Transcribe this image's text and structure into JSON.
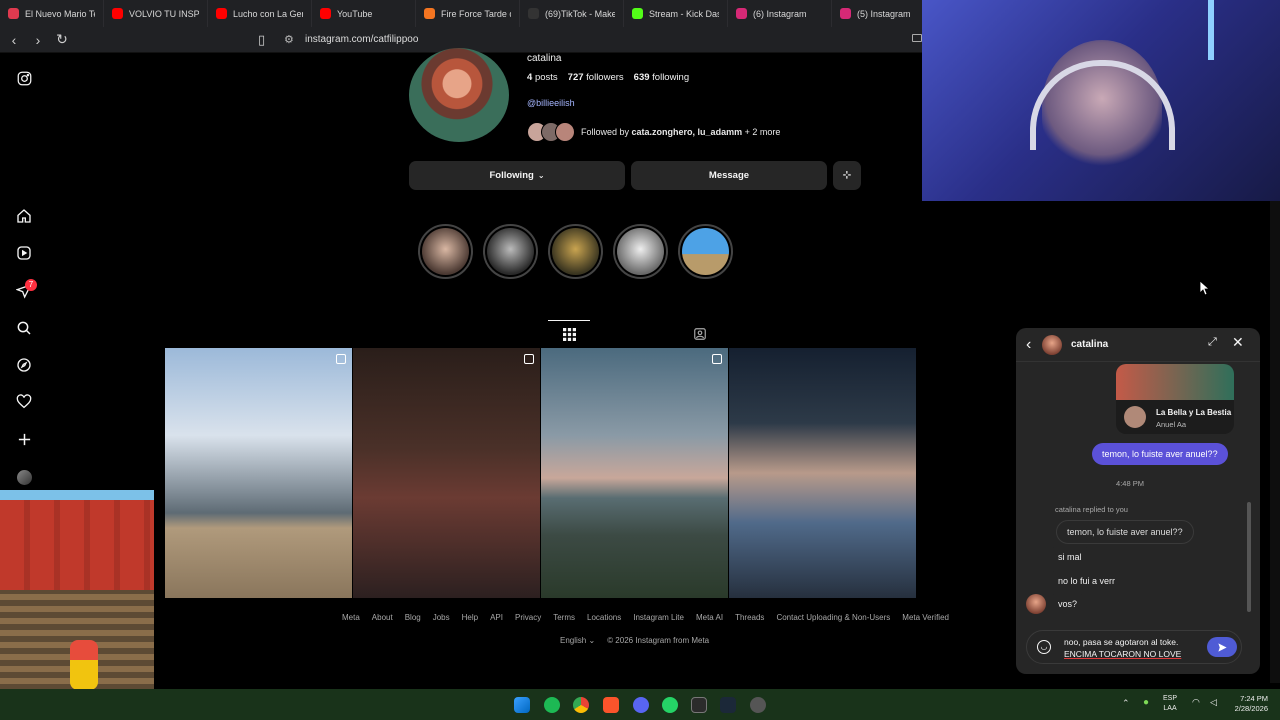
{
  "browser": {
    "tabs": [
      {
        "title": "El Nuevo Mario Ten",
        "color": "#e03a4f"
      },
      {
        "title": "VOLVIO TU INSPECT",
        "color": "#ff0000"
      },
      {
        "title": "Lucho con La Gente",
        "color": "#ff0000"
      },
      {
        "title": "YouTube",
        "color": "#ff0000"
      },
      {
        "title": "Fire Force Tarde de",
        "color": "#f47521"
      },
      {
        "title": "(69)TikTok - Make Y",
        "color": "#222222"
      },
      {
        "title": "Stream - Kick Dashb",
        "color": "#53fc18"
      },
      {
        "title": "(6) Instagram",
        "color": "#d62976"
      },
      {
        "title": "(5) Instagram",
        "color": "#d62976"
      }
    ],
    "url": "instagram.com/catfilippoo"
  },
  "sidebar": {
    "notifications_count": "7"
  },
  "profile": {
    "username": "catalina",
    "posts_count": "4",
    "posts_label": "posts",
    "followers_count": "727",
    "followers_label": "followers",
    "following_count": "639",
    "following_label": "following",
    "bio_link": "@billieeilish",
    "followed_by_prefix": "Followed by",
    "followed_by_names": "cata.zonghero, lu_adamm",
    "followed_by_more": "+ 2 more",
    "following_button": "Following",
    "message_button": "Message"
  },
  "footer": {
    "links": [
      "Meta",
      "About",
      "Blog",
      "Jobs",
      "Help",
      "API",
      "Privacy",
      "Terms",
      "Locations",
      "Instagram Lite",
      "Meta AI",
      "Threads",
      "Contact Uploading & Non-Users",
      "Meta Verified"
    ],
    "language": "English",
    "copyright": "© 2026 Instagram from Meta"
  },
  "chat": {
    "contact_name": "catalina",
    "shared_song_title": "La Bella y La Bestia",
    "shared_song_artist": "Anuel Aa",
    "msg_out_1": "temon, lo fuiste aver anuel??",
    "timestamp": "4:48 PM",
    "reply_note": "catalina replied to you",
    "quoted_reply": "temon, lo fuiste aver anuel??",
    "msg_in_1": "si mal",
    "msg_in_2": "no lo fui a verr",
    "msg_in_3": "vos?",
    "composer_line_1": "noo, pasa se agotaron al toke.",
    "composer_line_2": "ENCIMA TOCARON NO LOVE"
  },
  "taskbar": {
    "lang_top": "ESP",
    "lang_bottom": "LAA",
    "time": "7:24 PM",
    "date": "2/28/2026"
  }
}
